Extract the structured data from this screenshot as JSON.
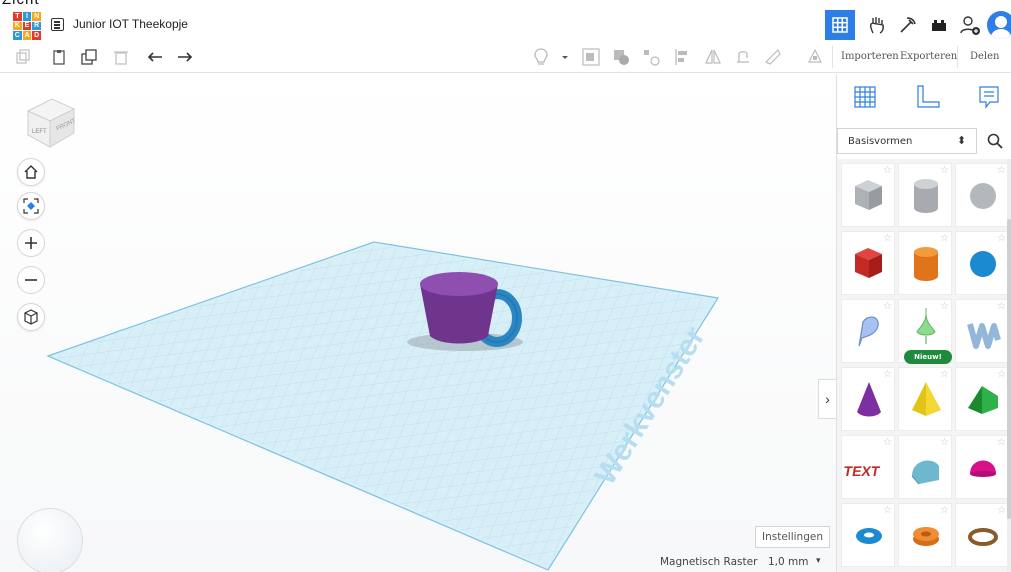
{
  "window": {
    "top_text": "Zicht",
    "title": "Junior IOT Theekopje",
    "logo_letters": [
      "T",
      "I",
      "N",
      "K",
      "E",
      "R",
      "C",
      "A",
      "D"
    ],
    "accent_color": "#2d7ee6"
  },
  "toolbar": {
    "import_label": "Importeren",
    "export_label": "Exporteren",
    "share_label": "Delen",
    "icons": [
      "copy-icon",
      "paste-icon",
      "duplicate-icon",
      "delete-icon",
      "undo-icon",
      "redo-icon",
      "light-icon",
      "dropdown-icon",
      "group-icon",
      "ungroup-icon",
      "align-icon",
      "distribute-icon",
      "mirror-icon",
      "cruise-icon",
      "ruler-icon",
      "workplane-icon"
    ]
  },
  "viewport": {
    "viewcube_left": "LEFT",
    "viewcube_front": "FRONT",
    "workplane_label": "Werkvenster",
    "settings_label": "Instellingen",
    "snap_label": "Magnetisch Raster",
    "snap_value": "1,0 mm",
    "colors": {
      "cup": "#7b3c9a",
      "cup_top": "#8e4fb0",
      "handle": "#2a87c4",
      "grid_plane": "#cfeaf5",
      "grid_line": "#a9d8ec"
    }
  },
  "panel": {
    "category_label": "Basisvormen",
    "new_badge": "Nieuw!",
    "novelty_text": "TEXT",
    "shapes": [
      [
        "box-hole",
        "cylinder-hole",
        "sphere-hole"
      ],
      [
        "box",
        "cylinder",
        "sphere"
      ],
      [
        "scribble",
        "spinner",
        "wave"
      ],
      [
        "cone",
        "pyramid",
        "roof"
      ],
      [
        "text",
        "round-roof",
        "half-sphere"
      ],
      [
        "torus",
        "tube",
        "ring"
      ]
    ]
  }
}
